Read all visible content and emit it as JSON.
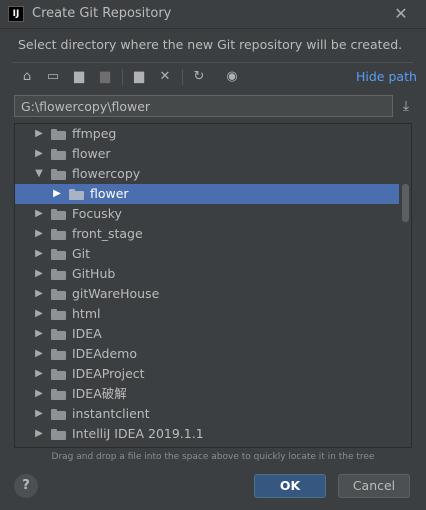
{
  "window": {
    "title": "Create Git Repository",
    "app_icon": "intellij-icon",
    "close_glyph": "✕"
  },
  "description": "Select directory where the new Git repository will be created.",
  "toolbar": {
    "buttons": [
      {
        "icon": "home-icon",
        "glyph": "⌂"
      },
      {
        "icon": "desktop-icon",
        "glyph": "▭"
      },
      {
        "icon": "project-folder-icon",
        "glyph": "▆"
      },
      {
        "icon": "module-folder-icon",
        "glyph": "▆"
      },
      {
        "icon": "new-folder-icon",
        "glyph": "▆"
      },
      {
        "icon": "delete-icon",
        "glyph": "✕"
      },
      {
        "icon": "refresh-icon",
        "glyph": "↻"
      },
      {
        "icon": "show-hidden-icon",
        "glyph": "◉"
      }
    ],
    "hide_path_label": "Hide path"
  },
  "path": {
    "value": "G:\\flowercopy\\flower",
    "download_glyph": "⤓"
  },
  "tree": {
    "items": [
      {
        "label": "ffmpeg",
        "expanded": false,
        "selected": false
      },
      {
        "label": "flower",
        "expanded": false,
        "selected": false
      },
      {
        "label": "flowercopy",
        "expanded": true,
        "selected": false
      },
      {
        "label": "flower",
        "expanded": false,
        "selected": true
      },
      {
        "label": "Focusky",
        "expanded": false,
        "selected": false
      },
      {
        "label": "front_stage",
        "expanded": false,
        "selected": false
      },
      {
        "label": "Git",
        "expanded": false,
        "selected": false
      },
      {
        "label": "GitHub",
        "expanded": false,
        "selected": false
      },
      {
        "label": "gitWareHouse",
        "expanded": false,
        "selected": false
      },
      {
        "label": "html",
        "expanded": false,
        "selected": false
      },
      {
        "label": "IDEA",
        "expanded": false,
        "selected": false
      },
      {
        "label": "IDEAdemo",
        "expanded": false,
        "selected": false
      },
      {
        "label": "IDEAProject",
        "expanded": false,
        "selected": false
      },
      {
        "label": "IDEA破解",
        "expanded": false,
        "selected": false
      },
      {
        "label": "instantclient",
        "expanded": false,
        "selected": false
      },
      {
        "label": "IntelliJ IDEA 2019.1.1",
        "expanded": false,
        "selected": false
      }
    ]
  },
  "hint": "Drag and drop a file into the space above to quickly locate it in the tree",
  "buttons": {
    "help": "?",
    "ok": "OK",
    "cancel": "Cancel"
  },
  "colors": {
    "background": "#3c3f41",
    "selection": "#4b6eaf",
    "link": "#589df6",
    "ok_button": "#365880"
  }
}
